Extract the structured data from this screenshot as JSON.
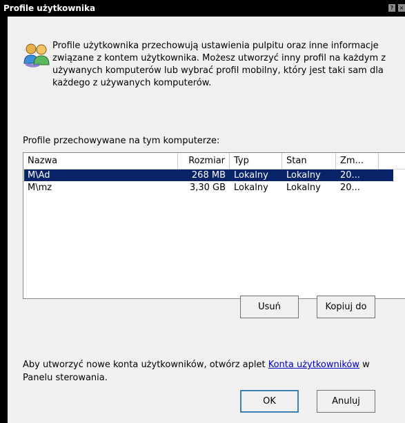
{
  "window": {
    "title": "Profile użytkownika",
    "title_buttons": [
      "?",
      "×"
    ]
  },
  "info": {
    "icon": "users-icon",
    "text": "Profile użytkownika przechowują ustawienia pulpitu oraz inne informacje związane z kontem użytkownika. Możesz utworzyć inny profil na każdym z używanych komputerów lub wybrać profil mobilny, który jest taki sam dla każdego z używanych komputerów."
  },
  "profiles": {
    "label": "Profile przechowywane na tym komputerze:",
    "columns": [
      "Nazwa",
      "Rozmiar",
      "Typ",
      "Stan",
      "Zm..."
    ],
    "rows": [
      {
        "name": "M\\Ad",
        "size": "268 MB",
        "type": "Lokalny",
        "status": "Lokalny",
        "modified": "20...",
        "selected": true
      },
      {
        "name": "M\\mz",
        "size": "3,30 GB",
        "type": "Lokalny",
        "status": "Lokalny",
        "modified": "20...",
        "selected": false
      }
    ]
  },
  "buttons": {
    "delete": "Usuń",
    "copy_to": "Kopiuj do",
    "ok": "OK",
    "cancel": "Anuluj"
  },
  "footer": {
    "text_before": "Aby utworzyć nowe konta użytkowników, otwórz aplet ",
    "link": "Konta użytkowników",
    "text_after": " w Panelu sterowania."
  },
  "colors": {
    "selection": "#0a246a",
    "link": "#0000cc",
    "default_button_border": "#3c7fb1"
  }
}
